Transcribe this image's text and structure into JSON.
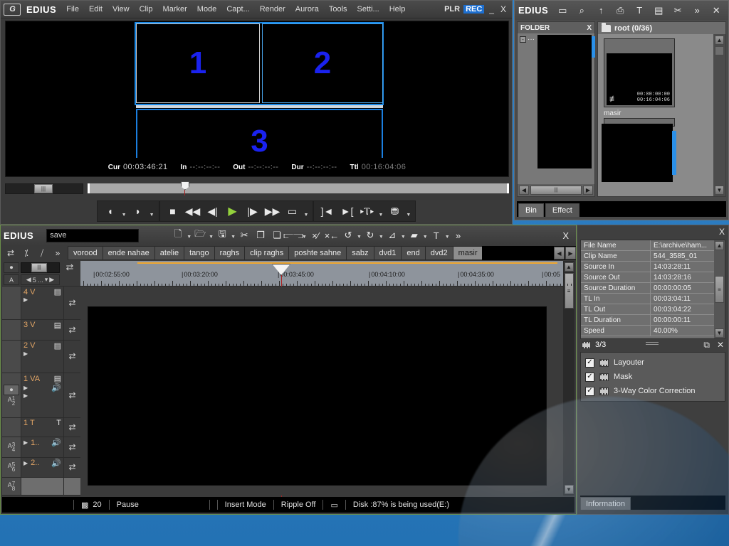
{
  "player": {
    "app_name": "EDIUS",
    "logo": "edius-logo-icon",
    "menus": [
      "File",
      "Edit",
      "View",
      "Clip",
      "Marker",
      "Mode",
      "Capt...",
      "Render",
      "Aurora",
      "Tools",
      "Setti...",
      "Help"
    ],
    "mode_plr": "PLR",
    "mode_rec": "REC",
    "minimize": "_",
    "close": "X",
    "preview": {
      "pip_labels": [
        "1",
        "2",
        "3"
      ],
      "pip_color": "#1a22ef",
      "border_color": "#1b7fe0"
    },
    "timecodes": {
      "cur_label": "Cur",
      "cur_value": "00:03:46:21",
      "in_label": "In",
      "in_value": "--:--:--:--",
      "out_label": "Out",
      "out_value": "--:--:--:--",
      "dur_label": "Dur",
      "dur_value": "--:--:--:--",
      "ttl_label": "Ttl",
      "ttl_value": "00:16:04:06"
    },
    "transport": {
      "set_in": "◖",
      "set_out": "◗",
      "stop": "■",
      "rew": "◀◀",
      "prev_frame": "◀|",
      "play": "▶",
      "next_frame": "|▶",
      "ff": "▶▶",
      "loop": "▭",
      "to_in": "]◄",
      "to_out": "►[",
      "add_marker": "▸Ⲧ▸",
      "export": "⛃"
    }
  },
  "bin": {
    "app_name": "EDIUS",
    "toolbar_icons": [
      "new-folder-icon",
      "search-icon",
      "up-folder-icon",
      "add-bin-icon",
      "title-icon",
      "color-bar-icon",
      "cut-icon",
      "more-icon",
      "close-icon"
    ],
    "folder_pane": {
      "title": "FOLDER",
      "close": "X",
      "expander": "-",
      "root_label": ""
    },
    "clip_pane": {
      "folder_label": "root (0/36)",
      "clips": [
        {
          "name": "masir",
          "tc_in": "00:00:00:00",
          "tc_dur": "00:16:04:06"
        },
        {
          "name": "",
          "tc_in": "",
          "tc_dur": ""
        }
      ]
    },
    "tabs": [
      {
        "label": "Bin",
        "selected": true
      },
      {
        "label": "Effect",
        "selected": false
      }
    ]
  },
  "timeline": {
    "app_name": "EDIUS",
    "project_name": "save",
    "toolbar_icons": [
      "new-project-icon",
      "open-project-icon",
      "save-project-icon",
      "cut-icon",
      "copy-icon",
      "paste-icon",
      "group-icon",
      "delete-with-gap-icon",
      "delete-icon",
      "undo-icon",
      "redo-icon",
      "add-transition-icon",
      "add-effect-icon",
      "title-icon",
      "more-icon"
    ],
    "close": "X",
    "sequence_tabs": [
      {
        "label": "vorood",
        "selected": false
      },
      {
        "label": "ende nahae",
        "selected": false
      },
      {
        "label": "atelie",
        "selected": false
      },
      {
        "label": "tango",
        "selected": false
      },
      {
        "label": "raghs",
        "selected": false
      },
      {
        "label": "clip raghs",
        "selected": false
      },
      {
        "label": "poshte sahne",
        "selected": false
      },
      {
        "label": "sabz",
        "selected": false
      },
      {
        "label": "dvd1",
        "selected": false
      },
      {
        "label": "end",
        "selected": false
      },
      {
        "label": "dvd2",
        "selected": false
      },
      {
        "label": "masir",
        "selected": true
      }
    ],
    "tab_nav": {
      "prev": "◀",
      "next": "▶"
    },
    "track_zoom_value": "5 ...",
    "ruler_labels": [
      "00:02:55:00",
      "00:03:20:00",
      "00:03:45:00",
      "00:04:10:00",
      "00:04:35:00",
      "00:05"
    ],
    "tracks": [
      {
        "name": "4 V",
        "type": "video",
        "has_expand": true,
        "has_audio": false
      },
      {
        "name": "3 V",
        "type": "video",
        "has_expand": false,
        "has_audio": false
      },
      {
        "name": "2 V",
        "type": "video",
        "has_expand": true,
        "has_audio": false
      },
      {
        "name": "1 VA",
        "type": "video-audio",
        "has_expand": true,
        "has_audio": true,
        "channels": [
          "1",
          "2"
        ]
      },
      {
        "name": "1 T",
        "type": "title",
        "has_expand": false,
        "has_audio": false
      },
      {
        "name": "1..",
        "type": "audio",
        "has_expand": true,
        "has_audio": true,
        "channels": [
          "3",
          "4"
        ]
      },
      {
        "name": "2..",
        "type": "audio",
        "has_expand": true,
        "has_audio": true,
        "channels": [
          "5",
          "6"
        ]
      },
      {
        "name": "",
        "type": "audio",
        "has_expand": false,
        "has_audio": false,
        "channels": [
          "7",
          "8"
        ]
      }
    ],
    "status": {
      "fps_icon": "frame-icon",
      "fps": "20",
      "state": "Pause",
      "edit_mode": "Insert Mode",
      "ripple": "Ripple Off",
      "monitor_icon": "monitor-icon",
      "disk": "Disk :87% is being used(E:)"
    }
  },
  "info_panel": {
    "close": "X",
    "properties": [
      {
        "key": "File Name",
        "value": "E:\\archive\\ham..."
      },
      {
        "key": "Clip Name",
        "value": "544_3585_01"
      },
      {
        "key": "Source In",
        "value": "14:03:28:11"
      },
      {
        "key": "Source Out",
        "value": "14:03:28:16"
      },
      {
        "key": "Source Duration",
        "value": "00:00:00:05"
      },
      {
        "key": "TL In",
        "value": "00:03:04:11"
      },
      {
        "key": "TL Out",
        "value": "00:03:04:22"
      },
      {
        "key": "TL Duration",
        "value": "00:00:00:11"
      },
      {
        "key": "Speed",
        "value": "40.00%"
      }
    ],
    "effects": {
      "count": "3/3",
      "expand_icon": "expand-all-icon",
      "close_icon": "close-icon",
      "items": [
        {
          "label": "Layouter",
          "checked": true,
          "icon": "layouter-icon"
        },
        {
          "label": "Mask",
          "checked": true,
          "icon": "mask-icon"
        },
        {
          "label": "3-Way Color Correction",
          "checked": true,
          "icon": "color-correction-icon"
        }
      ]
    },
    "tabs": [
      {
        "label": "Information",
        "selected": true
      }
    ]
  },
  "colors": {
    "accent_blue": "#1d6fd0",
    "play_green": "#93d13c",
    "track_label": "#dfa35e",
    "ruler_bg": "#8e949c",
    "orange_marker": "#f0a830",
    "desktop": "#2e7bc4"
  }
}
